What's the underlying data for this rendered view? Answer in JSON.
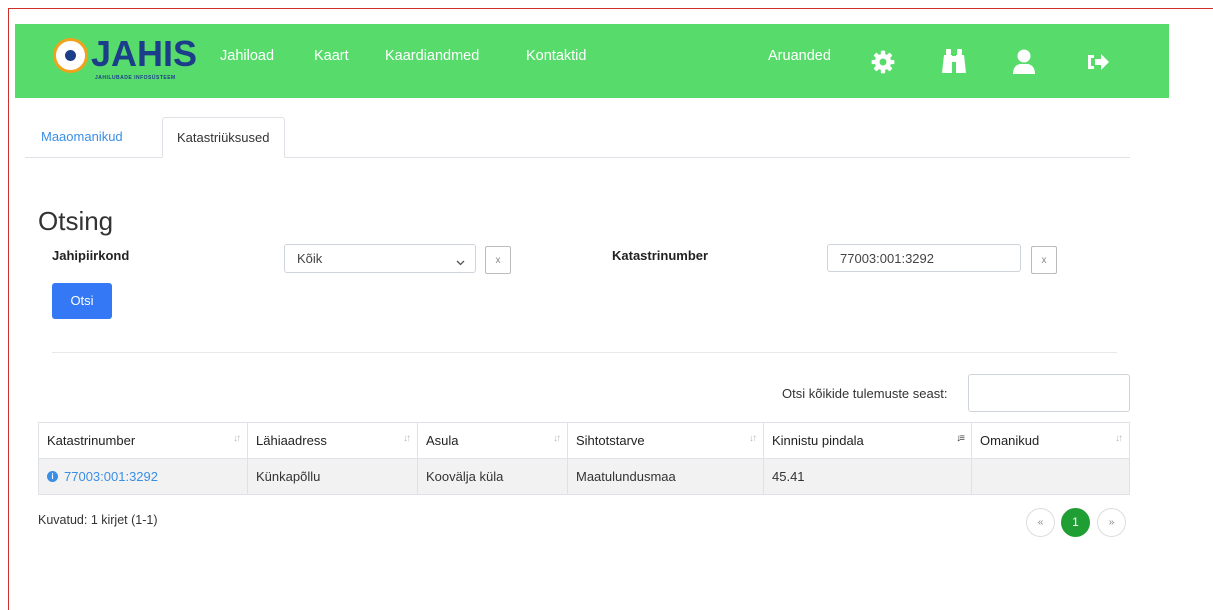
{
  "app": {
    "logo_text": "JAHIS",
    "logo_subtitle": "JAHILUBADE INFOSÜSTEEM"
  },
  "nav": {
    "links": [
      "Jahiload",
      "Kaart",
      "Kaardiandmed",
      "Kontaktid"
    ],
    "reports": "Aruanded",
    "icons": [
      "gear-icon",
      "binoculars-icon",
      "user-icon",
      "logout-icon"
    ]
  },
  "tabs": [
    {
      "label": "Maaomanikud",
      "active": false
    },
    {
      "label": "Katastriüksused",
      "active": true
    }
  ],
  "search": {
    "heading": "Otsing",
    "district_label": "Jahipiirkond",
    "district_value": "Kõik",
    "cadastre_label": "Katastrinumber",
    "cadastre_value": "77003:001:3292",
    "clear_label": "x",
    "submit_label": "Otsi",
    "global_label": "Otsi kõikide tulemuste seast:",
    "global_value": ""
  },
  "table": {
    "columns": [
      "Katastrinumber",
      "Lähiaadress",
      "Asula",
      "Sihtotstarve",
      "Kinnistu pindala",
      "Omanikud"
    ],
    "sorted_column": "Kinnistu pindala",
    "rows": [
      {
        "katastrinumber": "77003:001:3292",
        "lahiaadress": "Künkapõllu",
        "asula": "Koovälja küla",
        "sihtotstarve": "Maatulundusmaa",
        "pindala": "45.41",
        "omanikud": ""
      }
    ]
  },
  "footer": {
    "summary": "Kuvatud: 1 kirjet (1-1)",
    "prev": "«",
    "page": "1",
    "next": "»"
  },
  "colors": {
    "navbar": "#57dc6c",
    "logo": "#1c3d8a",
    "primary_button": "#3478f6",
    "pager_active": "#1f9e34",
    "link": "#3a8ee6"
  }
}
